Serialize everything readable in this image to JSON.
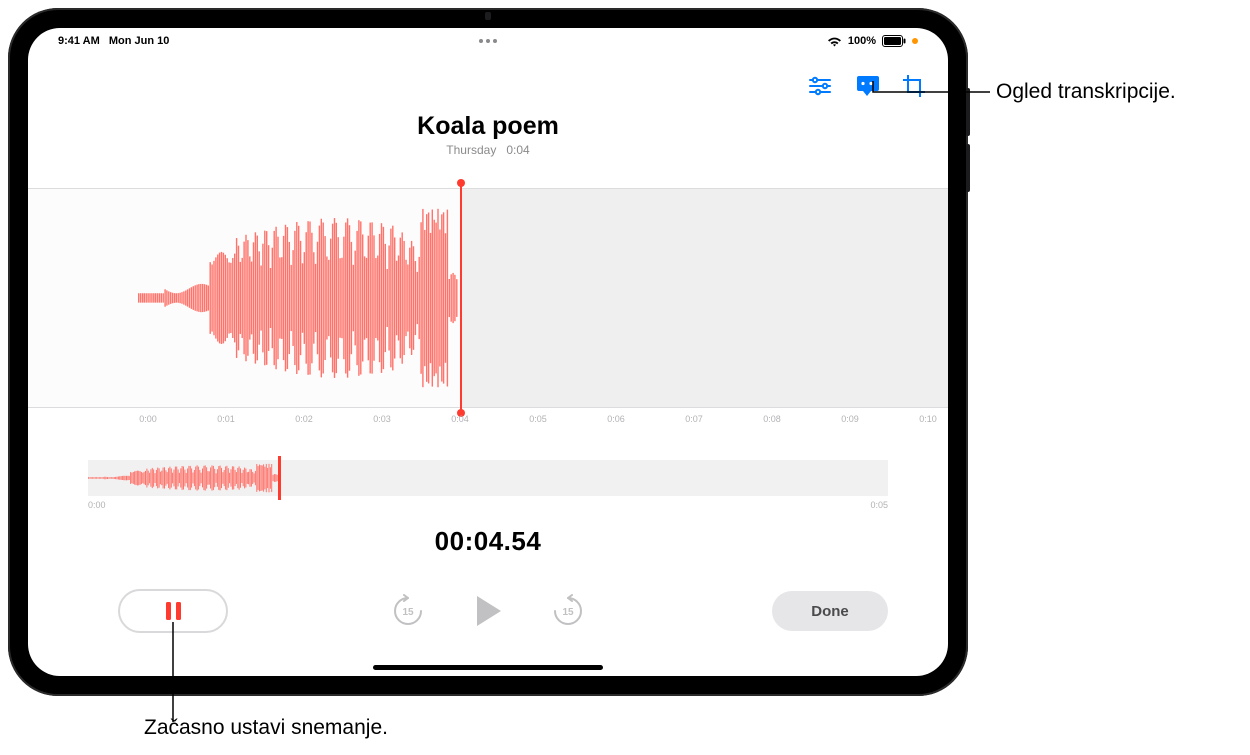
{
  "status": {
    "time": "9:41 AM",
    "date": "Mon Jun 10",
    "battery_pct": "100%"
  },
  "toolbar": {
    "settings_name": "playback-settings-icon",
    "transcript_name": "transcription-icon",
    "trim_name": "trim-icon"
  },
  "recording": {
    "title": "Koala poem",
    "subtitle_day": "Thursday",
    "subtitle_dur": "0:04"
  },
  "ruler": {
    "ticks": [
      "0:00",
      "0:01",
      "0:02",
      "0:03",
      "0:04",
      "0:05",
      "0:06",
      "0:07",
      "0:08",
      "0:09",
      "0:10"
    ]
  },
  "strip": {
    "start": "0:00",
    "end": "0:05"
  },
  "timer": "00:04.54",
  "buttons": {
    "done": "Done"
  },
  "callouts": {
    "c1": "Ogled transkripcije.",
    "c2": "Začasno ustavi snemanje."
  }
}
